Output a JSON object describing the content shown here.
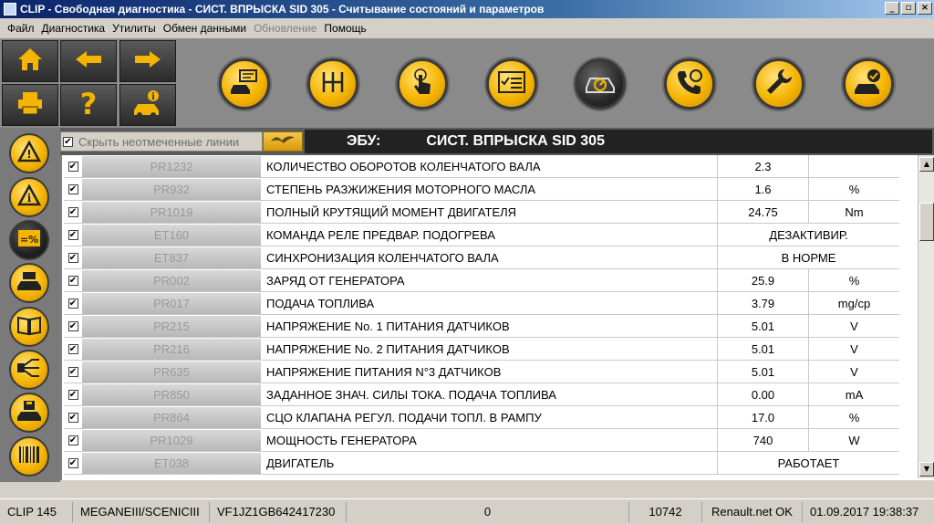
{
  "window": {
    "title": "CLIP - Свободная диагностика - СИСТ. ВПРЫСКА SID 305 - Считывание состояний и параметров",
    "min_glyph": "_",
    "max_glyph": "▫",
    "close_glyph": "×"
  },
  "menu": [
    "Файл",
    "Диагностика",
    "Утилиты",
    "Обмен данными",
    "Обновление",
    "Помощь"
  ],
  "filter": {
    "hide_label": "Скрыть неотмеченные линии",
    "checked_glyph": "✔"
  },
  "ecu": {
    "label": "ЭБУ:",
    "name": "СИСТ. ВПРЫСКА SID 305"
  },
  "rows": [
    {
      "code": "PR1232",
      "name": "КОЛИЧЕСТВО ОБОРОТОВ КОЛЕНЧАТОГО ВАЛА",
      "value": "2.3",
      "unit": ""
    },
    {
      "code": "PR932",
      "name": "СТЕПЕНЬ РАЗЖИЖЕНИЯ МОТОРНОГО МАСЛА",
      "value": "1.6",
      "unit": "%"
    },
    {
      "code": "PR1019",
      "name": "ПОЛНЫЙ КРУТЯЩИЙ МОМЕНТ ДВИГАТЕЛЯ",
      "value": "24.75",
      "unit": "Nm"
    },
    {
      "code": "ET160",
      "name": "КОМАНДА РЕЛЕ ПРЕДВАР. ПОДОГРЕВА",
      "state": "ДЕЗАКТИВИР."
    },
    {
      "code": "ET837",
      "name": "СИНХРОНИЗАЦИЯ КОЛЕНЧАТОГО ВАЛА",
      "state": "В НОРМЕ"
    },
    {
      "code": "PR002",
      "name": "ЗАРЯД ОТ ГЕНЕРАТОРА",
      "value": "25.9",
      "unit": "%"
    },
    {
      "code": "PR017",
      "name": "ПОДАЧА ТОПЛИВА",
      "value": "3.79",
      "unit": "mg/cp"
    },
    {
      "code": "PR215",
      "name": "НАПРЯЖЕНИЕ No. 1 ПИТАНИЯ ДАТЧИКОВ",
      "value": "5.01",
      "unit": "V"
    },
    {
      "code": "PR216",
      "name": "НАПРЯЖЕНИЕ No. 2 ПИТАНИЯ ДАТЧИКОВ",
      "value": "5.01",
      "unit": "V"
    },
    {
      "code": "PR635",
      "name": "НАПРЯЖЕНИЕ ПИТАНИЯ N°3 ДАТЧИКОВ",
      "value": "5.01",
      "unit": "V"
    },
    {
      "code": "PR850",
      "name": "ЗАДАННОЕ ЗНАЧ. СИЛЫ ТОКА. ПОДАЧА ТОПЛИВА",
      "value": "0.00",
      "unit": "mA"
    },
    {
      "code": "PR864",
      "name": "СЦО КЛАПАНА РЕГУЛ. ПОДАЧИ ТОПЛ. В РАМПУ",
      "value": "17.0",
      "unit": "%"
    },
    {
      "code": "PR1029",
      "name": "МОЩНОСТЬ ГЕНЕРАТОРА",
      "value": "740",
      "unit": "W"
    },
    {
      "code": "ET038",
      "name": "ДВИГАТЕЛЬ",
      "state": "РАБОТАЕТ"
    }
  ],
  "sidebar_badge": "=%",
  "status": {
    "clip": "CLIP 145",
    "vehicle": "MEGANEIII/SCENICIII",
    "vin": "VF1JZ1GB642417230",
    "counter": "0",
    "code": "10742",
    "net": "Renault.net OK",
    "datetime": "01.09.2017 19:38:37"
  },
  "colors": {
    "accent": "#f5b400",
    "toolbar_bg": "#8a8a8a",
    "header_bg": "#222222"
  },
  "icons": {
    "nav": [
      "home-icon",
      "arrow-left-icon",
      "arrow-right-icon",
      "printer-icon",
      "question-icon",
      "car-info-icon"
    ],
    "toolbar": [
      "ecu-car-icon",
      "gearbox-icon",
      "touch-icon",
      "checklist-icon",
      "speedometer-car-icon",
      "phone-support-icon",
      "wrench-icon",
      "car-check-icon"
    ],
    "sidebar": [
      "warning-icon",
      "warning-info-icon",
      "params-icon",
      "car-ecu-icon",
      "book-icon",
      "wiring-icon",
      "save-car-icon",
      "barcode-icon"
    ]
  }
}
